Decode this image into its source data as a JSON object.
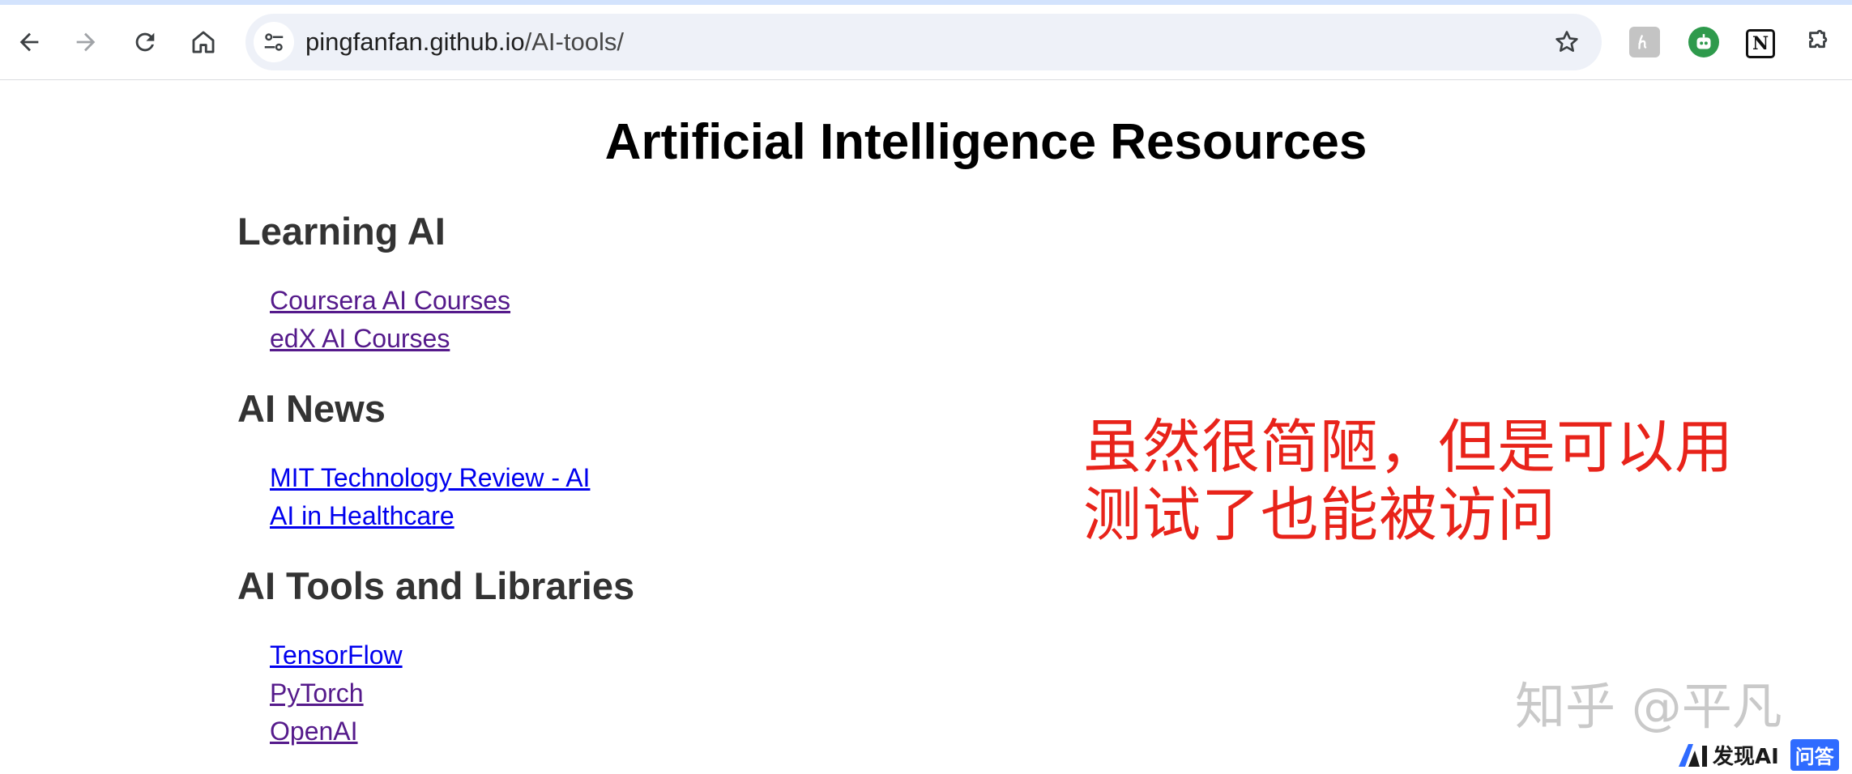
{
  "browser": {
    "url_host": "pingfanfan.github.io",
    "url_path": "/AI-tools/",
    "extensions": {
      "notion_letter": "N"
    }
  },
  "page": {
    "title": "Artificial Intelligence Resources",
    "sections": [
      {
        "heading": "Learning AI",
        "links": [
          {
            "label": "Coursera AI Courses",
            "state": "visited"
          },
          {
            "label": "edX AI Courses",
            "state": "visited"
          }
        ]
      },
      {
        "heading": "AI News",
        "links": [
          {
            "label": "MIT Technology Review - AI",
            "state": "unvisited"
          },
          {
            "label": "AI in Healthcare",
            "state": "unvisited"
          }
        ]
      },
      {
        "heading": "AI Tools and Libraries",
        "links": [
          {
            "label": "TensorFlow",
            "state": "unvisited"
          },
          {
            "label": "PyTorch",
            "state": "visited"
          },
          {
            "label": "OpenAI",
            "state": "visited"
          }
        ]
      }
    ]
  },
  "annotation": {
    "line1": "虽然很简陋，但是可以用",
    "line2": "测试了也能被访问",
    "color": "#e8231a"
  },
  "watermark": {
    "text": "知乎 @平凡"
  },
  "badge": {
    "brand": "发现AI",
    "tag": "问答"
  },
  "colors": {
    "link_visited": "#551a8b",
    "link_unvisited": "#0000ee",
    "heading": "#333333"
  }
}
